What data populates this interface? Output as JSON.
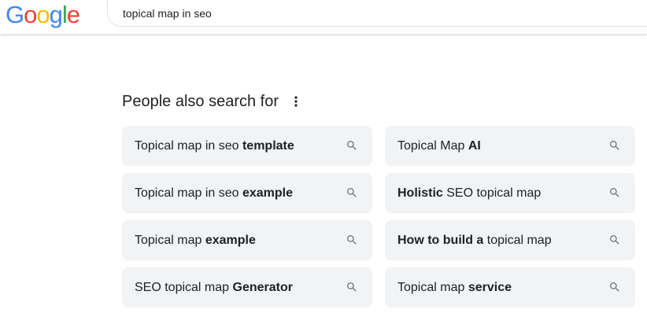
{
  "header": {
    "logo": {
      "letters": [
        {
          "char": "G",
          "color": "#4285F4"
        },
        {
          "char": "o",
          "color": "#EA4335"
        },
        {
          "char": "o",
          "color": "#FBBC05"
        },
        {
          "char": "g",
          "color": "#4285F4"
        },
        {
          "char": "l",
          "color": "#34A853"
        },
        {
          "char": "e",
          "color": "#EA4335"
        }
      ]
    },
    "search": {
      "value": "topical map in seo"
    }
  },
  "clipped_snippet": "",
  "people_also_search": {
    "title": "People also search for",
    "more_icon": "more-vert-icon",
    "items": [
      {
        "prefix": "Topical map in seo ",
        "bold": "template",
        "suffix": "",
        "icon": "search-icon"
      },
      {
        "prefix": "Topical Map ",
        "bold": "AI",
        "suffix": "",
        "icon": "search-icon"
      },
      {
        "prefix": "Topical map in seo ",
        "bold": "example",
        "suffix": "",
        "icon": "search-icon"
      },
      {
        "prefix": "",
        "bold": "Holistic",
        "suffix": " SEO topical map",
        "icon": "search-icon"
      },
      {
        "prefix": "Topical map ",
        "bold": "example",
        "suffix": "",
        "icon": "search-icon"
      },
      {
        "prefix": "",
        "bold": "How to build a",
        "suffix": " topical map",
        "icon": "search-icon"
      },
      {
        "prefix": "SEO topical map ",
        "bold": "Generator",
        "suffix": "",
        "icon": "search-icon"
      },
      {
        "prefix": "Topical map ",
        "bold": "service",
        "suffix": "",
        "icon": "search-icon"
      }
    ]
  },
  "colors": {
    "chip_background": "#f1f3f4",
    "text": "#202124",
    "icon": "#70757a"
  }
}
